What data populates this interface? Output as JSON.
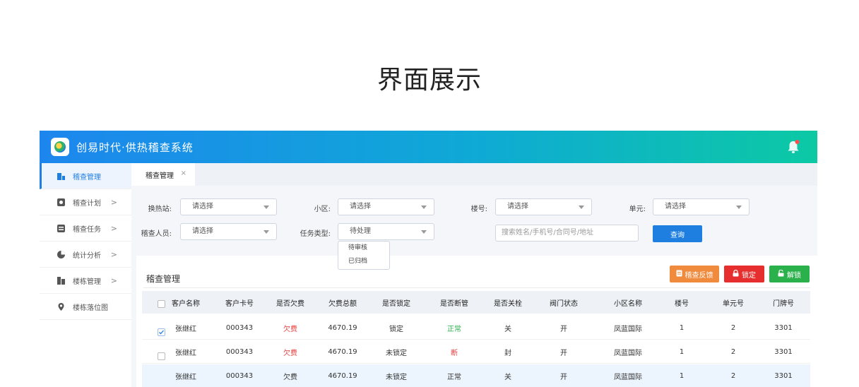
{
  "page_title": "界面展示",
  "app": {
    "title": "创易时代·供热稽查系统"
  },
  "sidebar": {
    "items": [
      {
        "label": "稽查管理",
        "icon": "building-icon",
        "chevron": ""
      },
      {
        "label": "稽查计划",
        "icon": "plan-icon",
        "chevron": ">"
      },
      {
        "label": "稽查任务",
        "icon": "task-icon",
        "chevron": ">"
      },
      {
        "label": "统计分析",
        "icon": "pie-chart-icon",
        "chevron": ">"
      },
      {
        "label": "楼栋管理",
        "icon": "buildings-icon",
        "chevron": ">"
      },
      {
        "label": "楼栋落位图",
        "icon": "location-icon",
        "chevron": ""
      }
    ]
  },
  "tabs": [
    {
      "label": "稽查管理",
      "close": "×"
    }
  ],
  "filters": {
    "station_label": "换热站:",
    "station_value": "请选择",
    "community_label": "小区:",
    "community_value": "请选择",
    "building_label": "楼号:",
    "building_value": "请选择",
    "unit_label": "单元:",
    "unit_value": "请选择",
    "inspector_label": "稽查人员:",
    "inspector_value": "请选择",
    "task_type_label": "任务类型:",
    "task_type_value": "待处理",
    "task_type_options": [
      "待审核",
      "已归档"
    ],
    "search_placeholder": "搜索姓名/手机号/合同号/地址",
    "query_button": "查询"
  },
  "panel": {
    "title": "稽查管理",
    "buttons": {
      "feedback": "稽查反馈",
      "lock": "锁定",
      "unlock": "解锁"
    }
  },
  "table": {
    "headers": [
      "客户名称",
      "客户卡号",
      "是否欠费",
      "欠费总额",
      "是否锁定",
      "是否断管",
      "是否关栓",
      "阀门状态",
      "小区名称",
      "楼号",
      "单元号",
      "门牌号"
    ],
    "rows": [
      {
        "checked": true,
        "cells": [
          "张继红",
          "000343",
          "欠费",
          "4670.19",
          "锁定",
          "正常",
          "关",
          "开",
          "凤蓝国际",
          "1",
          "2",
          "3301"
        ]
      },
      {
        "checked": false,
        "cells": [
          "张继红",
          "000343",
          "欠费",
          "4670.19",
          "未锁定",
          "断",
          "封",
          "开",
          "凤蓝国际",
          "1",
          "2",
          "3301"
        ]
      },
      {
        "checked": false,
        "cells": [
          "张继红",
          "000343",
          "欠费",
          "4670.19",
          "未锁定",
          "正常",
          "关",
          "开",
          "凤蓝国际",
          "1",
          "2",
          "3301"
        ]
      }
    ]
  },
  "colors": {
    "primary": "#1f7fe0",
    "danger": "#e83c3c",
    "success": "#2bb14c",
    "warning": "#f08a3c",
    "gradient_end": "#0cc9a4"
  }
}
